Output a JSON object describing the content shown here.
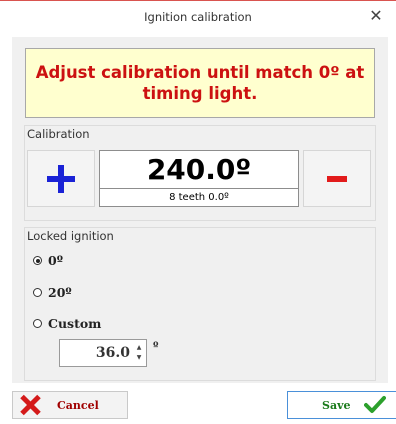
{
  "window": {
    "title": "Ignition calibration",
    "close_symbol": "✕"
  },
  "banner": {
    "message": "Adjust calibration until match 0º at timing light."
  },
  "calibration": {
    "label": "Calibration",
    "plus_icon": "plus-icon",
    "minus_icon": "minus-icon",
    "value": "240.0º",
    "detail": "8 teeth 0.0º"
  },
  "locked_ignition": {
    "label": "Locked ignition",
    "options": [
      {
        "label": "0º",
        "selected": true
      },
      {
        "label": "20º",
        "selected": false
      },
      {
        "label": "Custom",
        "selected": false
      }
    ],
    "custom_value": "36.0",
    "custom_unit": "º",
    "spin_up": "▲",
    "spin_down": "▼"
  },
  "footer": {
    "cancel_label": "Cancel",
    "save_label": "Save"
  },
  "colors": {
    "banner_text": "#cc1111",
    "banner_bg": "#ffffcf",
    "plus": "#1a22d6",
    "minus": "#e21b1b",
    "save_border": "#4a90d9",
    "save_check": "#2ca02c",
    "cancel_x": "#d41a1a"
  }
}
